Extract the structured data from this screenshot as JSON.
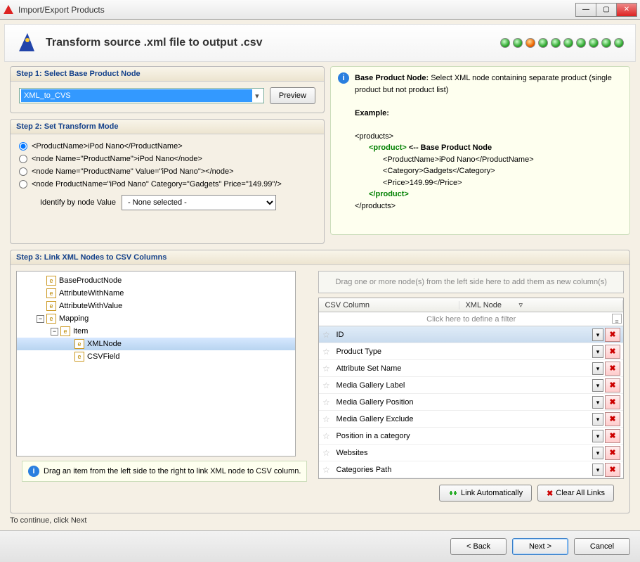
{
  "window": {
    "title": "Import/Export Products"
  },
  "header": {
    "title": "Transform source .xml file to output .csv"
  },
  "step1": {
    "title": "Step 1: Select Base Product Node",
    "comboValue": "XML_to_CVS",
    "previewBtn": "Preview"
  },
  "step2": {
    "title": "Step 2: Set Transform Mode",
    "radios": [
      "<ProductName>iPod Nano</ProductName>",
      "<node Name=\"ProductName\">iPod Nano</node>",
      "<node Name=\"ProductName\" Value=\"iPod Nano\"></node>",
      "<node ProductName=\"iPod Nano\" Category=\"Gadgets\" Price=\"149.99\"/>"
    ],
    "identifyLabel": "Identify by node Value",
    "identifySelect": "- None selected -"
  },
  "info": {
    "leadLabel": "Base Product Node:",
    "leadText": " Select XML node containing separate product (single product but not product list)",
    "exampleLabel": "Example:",
    "xmlOpen": "<products>",
    "prodOpen": "<product>",
    "baseNote": " <-- Base Product Node",
    "line1": "<ProductName>iPod Nano</ProductName>",
    "line2": "<Category>Gadgets</Category>",
    "line3": "<Price>149.99</Price>",
    "prodClose": "</product>",
    "xmlClose": "</products>"
  },
  "step3": {
    "title": "Step 3: Link XML Nodes to CSV Columns",
    "tree": [
      {
        "level": 1,
        "exp": null,
        "label": "BaseProductNode"
      },
      {
        "level": 1,
        "exp": null,
        "label": "AttributeWithName"
      },
      {
        "level": 1,
        "exp": null,
        "label": "AttributeWithValue"
      },
      {
        "level": 1,
        "exp": "-",
        "label": "Mapping"
      },
      {
        "level": 2,
        "exp": "-",
        "label": "Item"
      },
      {
        "level": 3,
        "exp": null,
        "label": "XMLNode",
        "sel": true
      },
      {
        "level": 3,
        "exp": null,
        "label": "CSVField"
      }
    ],
    "dragHint": "Drag one or more node(s) from the left side here to add them as new column(s)",
    "colCSV": "CSV Column",
    "colXML": "XML Node",
    "filterHint": "Click here to define a filter",
    "rows": [
      {
        "name": "ID",
        "sel": true
      },
      {
        "name": "Product Type"
      },
      {
        "name": "Attribute Set Name"
      },
      {
        "name": "Media Gallery Label"
      },
      {
        "name": "Media Gallery Position"
      },
      {
        "name": "Media Gallery Exclude"
      },
      {
        "name": "Position in a category"
      },
      {
        "name": "Websites"
      },
      {
        "name": "Categories Path"
      }
    ],
    "hint": "Drag an item from the left side to the right to link XML node to CSV column.",
    "linkAutoBtn": "Link Automatically",
    "clearBtn": "Clear All Links"
  },
  "footer": {
    "continueText": "To continue, click Next",
    "back": "< Back",
    "next": "Next >",
    "cancel": "Cancel"
  }
}
